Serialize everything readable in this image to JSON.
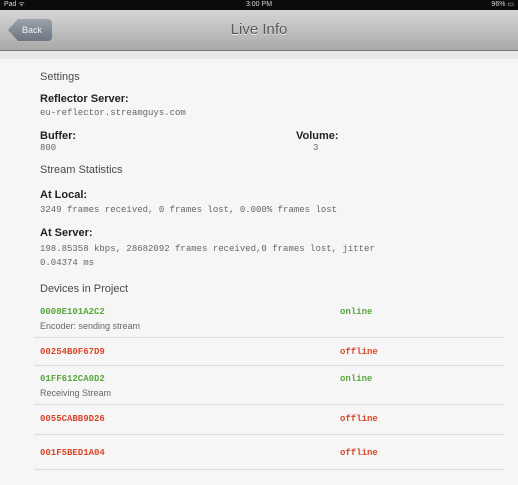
{
  "status_bar": {
    "left": "Pad ᯤ",
    "center": "3:00 PM",
    "right": "96% ▭"
  },
  "nav": {
    "back_label": "Back",
    "title": "Live Info"
  },
  "settings": {
    "heading": "Settings",
    "reflector_label": "Reflector Server:",
    "reflector_value": "eu-reflector.streamguys.com",
    "buffer_label": "Buffer:",
    "buffer_value": "800",
    "volume_label": "Volume:",
    "volume_value": "3"
  },
  "stats": {
    "heading": "Stream Statistics",
    "local_label": "At Local:",
    "local_value": "3249 frames received, 0 frames lost, 0.000% frames lost",
    "server_label": "At Server:",
    "server_value_1": "198.85358 kbps, 28682092 frames received,0 frames lost, jitter",
    "server_value_2": "0.04374 ms"
  },
  "devices": {
    "heading": "Devices in Project",
    "items": [
      {
        "id": "0008E101A2C2",
        "status": "online",
        "sub": "Encoder: sending stream",
        "color": "#5aa73d"
      },
      {
        "id": "00254B0F67D9",
        "status": "offline",
        "sub": "",
        "color": "#d9472a"
      },
      {
        "id": "01FF612CA0D2",
        "status": "online",
        "sub": "Receiving Stream",
        "color": "#5aa73d"
      },
      {
        "id": "0055CABB9D26",
        "status": "offline",
        "sub": "",
        "color": "#d9472a"
      },
      {
        "id": "001F5BED1A04",
        "status": "offline",
        "sub": "",
        "color": "#d9472a"
      }
    ]
  }
}
